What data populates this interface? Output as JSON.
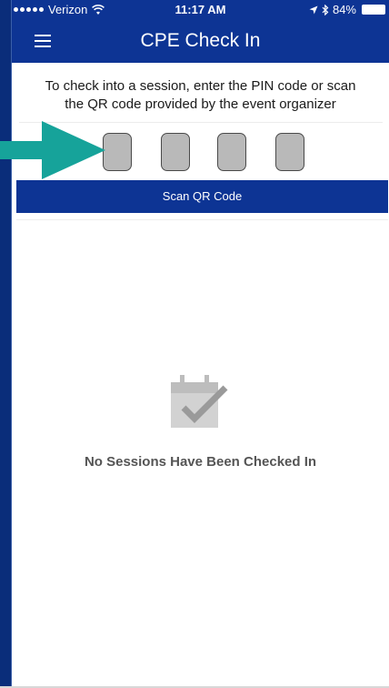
{
  "status_bar": {
    "carrier": "Verizon",
    "time": "11:17 AM",
    "battery": "84%"
  },
  "nav": {
    "title": "CPE Check In"
  },
  "instruction": {
    "line1": "To check into a session, enter the PIN code or scan",
    "line2": "the QR code provided by the event organizer"
  },
  "pin": {
    "digits": [
      "",
      "",
      "",
      ""
    ]
  },
  "scan_button": {
    "label": "Scan QR Code"
  },
  "empty_state": {
    "icon": "calendar-check-icon",
    "message": "No Sessions Have Been Checked In"
  },
  "colors": {
    "brand_blue": "#0d3494",
    "annotation_teal": "#16a39a",
    "pin_box": "#b9b9b9"
  }
}
